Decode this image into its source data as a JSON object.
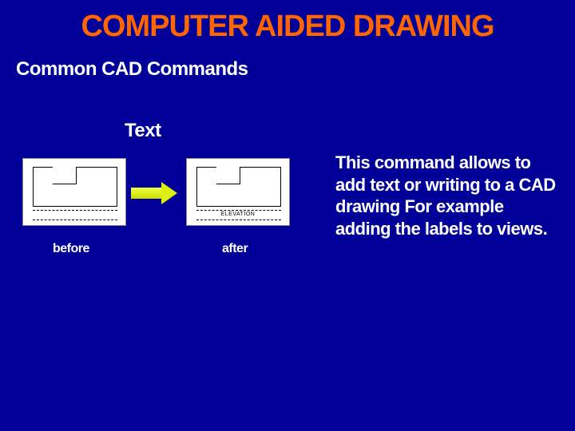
{
  "title": "COMPUTER AIDED DRAWING",
  "subtitle": "Common CAD Commands",
  "command": "Text",
  "description": "This command allows to add text or writing to a CAD drawing For example adding the labels to views.",
  "captions": {
    "before": "before",
    "after": "after"
  },
  "afterLabel": "ELEVATION"
}
